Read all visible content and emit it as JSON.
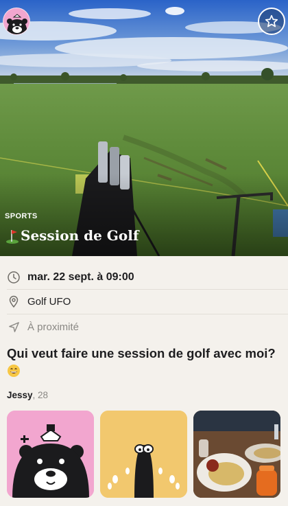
{
  "event": {
    "category": "SPORTS",
    "title": "Session de Golf",
    "date": "mar. 22 sept. à 09:00",
    "place": "Golf UFO",
    "distance": "À proximité",
    "question": "Qui veut faire une session de golf avec moi?"
  },
  "host": {
    "name": "Jessy",
    "age": ", 28"
  },
  "icons": {
    "avatar": "bear-avatar-icon",
    "favorite": "star-icon",
    "date": "clock-icon",
    "place": "location-pin-icon",
    "distance": "navigation-arrow-icon",
    "title_emoji": "golf-flag-icon",
    "question_emoji": "grinning-face-icon"
  },
  "colors": {
    "background": "#f4f1ec",
    "avatar_pink": "#f2a6cf",
    "avatar_yellow": "#f2c86e",
    "favorite_ring": "#ffffff"
  }
}
